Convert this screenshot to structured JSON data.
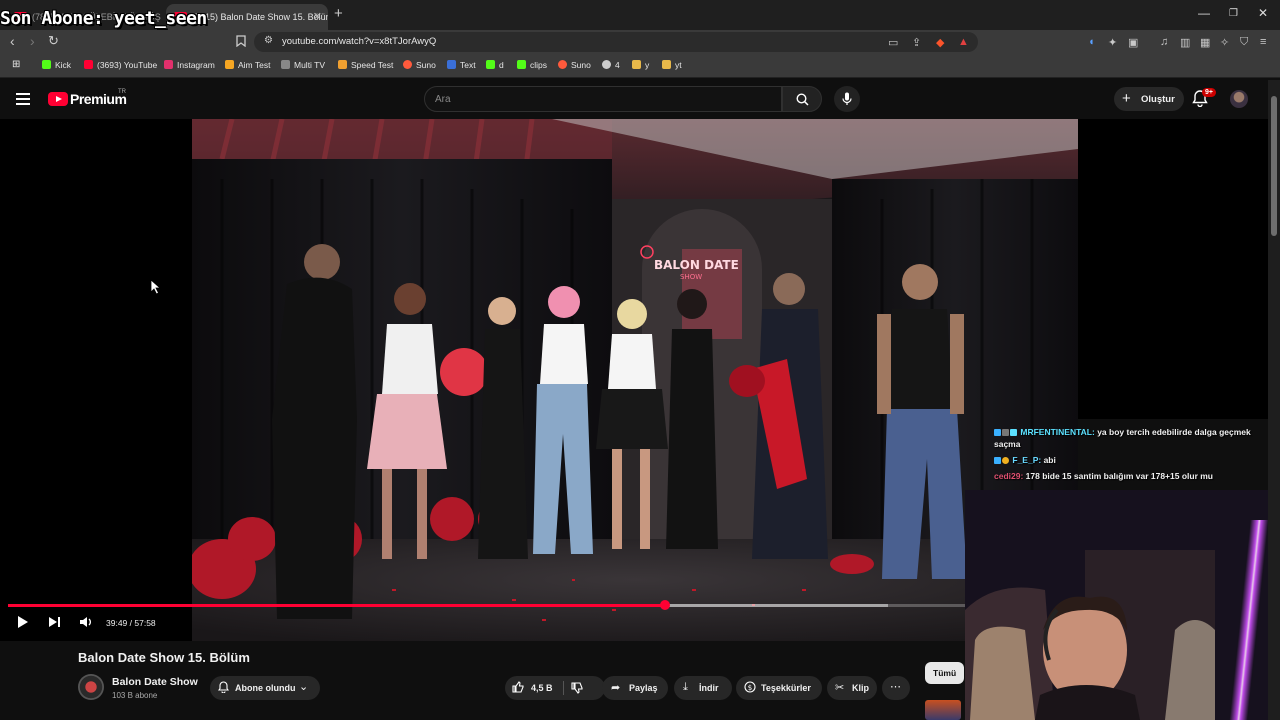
{
  "overlay": {
    "title": "Son Abone: yeet_seen"
  },
  "browser": {
    "tabs": [
      {
        "label": "(7815) ANIL GÜLEBİLE ÖLMÜŞ KİŞİN...",
        "active": false
      },
      {
        "label": "(7815) Balon Date Show 15. Bölüm",
        "active": true
      }
    ],
    "url": "youtube.com/watch?v=x8tTJorAwyQ",
    "bookmarks": [
      {
        "label": "Kick",
        "color": "#53fc18"
      },
      {
        "label": "(3693) YouTube",
        "color": "#ff0033"
      },
      {
        "label": "Instagram",
        "color": "#e1306c"
      },
      {
        "label": "Aim Test",
        "color": "#f5a623"
      },
      {
        "label": "Multi TV",
        "color": "#888888"
      },
      {
        "label": "Speed Test",
        "color": "#f0a030"
      },
      {
        "label": "Suno",
        "color": "#ff5a3c"
      },
      {
        "label": "Text",
        "color": "#3a6fd8"
      },
      {
        "label": "d",
        "color": "#53fc18"
      },
      {
        "label": "clips",
        "color": "#53fc18"
      },
      {
        "label": "Suno",
        "color": "#ff5a3c"
      },
      {
        "label": "4",
        "color": "#cccccc"
      },
      {
        "label": "y",
        "color": "#e8b84a"
      },
      {
        "label": "yt",
        "color": "#e8b84a"
      }
    ]
  },
  "youtube": {
    "logo_text": "Premium",
    "region": "TR",
    "search_placeholder": "Ara",
    "create_label": "Oluştur",
    "notification_count": "9+"
  },
  "player": {
    "neon_sign_line1": "BALON DATE",
    "neon_sign_line2": "SHOW",
    "current_time": "39:49",
    "duration": "57:58",
    "progress_fraction": 0.687,
    "buffered_fraction": 0.92
  },
  "video": {
    "title": "Balon Date Show 15. Bölüm",
    "channel": "Balon Date Show",
    "subscribers": "103 B abone",
    "subscribe_label": "Abone olundu",
    "likes": "4,5 B",
    "share_label": "Paylaş",
    "download_label": "İndir",
    "thanks_label": "Teşekkürler",
    "clip_label": "Klip",
    "filter_chip": "Tümü"
  },
  "chat": [
    {
      "user": "MRFENTINENTAL:",
      "message": "ya boy tercih edebilirde dalga geçmek",
      "message_cont": "saçma",
      "color": "#5ce1ff"
    },
    {
      "user": "F_E_P:",
      "message": "abi",
      "color": "#68d8ff"
    },
    {
      "user": "cedi29:",
      "message": "178 bide 15 santim balığım var 178+15 olur mu",
      "color": "#e05070"
    }
  ],
  "colors": {
    "accent": "#ff0033",
    "background": "#0f0f0f",
    "chrome": "#3a3a3a"
  }
}
